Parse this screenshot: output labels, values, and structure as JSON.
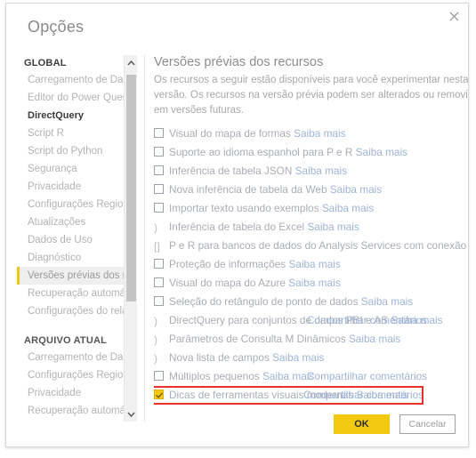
{
  "dialog": {
    "title": "Opções",
    "close_label": "×"
  },
  "sidebar": {
    "groups": [
      {
        "heading": "GLOBAL",
        "items": [
          {
            "label": "Carregamento de Dados",
            "selected": false,
            "bold": false
          },
          {
            "label": "Editor do Power Query",
            "selected": false,
            "bold": false
          },
          {
            "label": "DirectQuery",
            "selected": false,
            "bold": true
          },
          {
            "label": "Script R",
            "selected": false,
            "bold": false
          },
          {
            "label": "Script do Python",
            "selected": false,
            "bold": false
          },
          {
            "label": "Segurança",
            "selected": false,
            "bold": false
          },
          {
            "label": "Privacidade",
            "selected": false,
            "bold": false
          },
          {
            "label": "Configurações Regionais",
            "selected": false,
            "bold": false
          },
          {
            "label": "Atualizações",
            "selected": false,
            "bold": false
          },
          {
            "label": "Dados de Uso",
            "selected": false,
            "bold": false
          },
          {
            "label": "Diagnóstico",
            "selected": false,
            "bold": false
          },
          {
            "label": "Versões prévias dos recursos",
            "selected": true,
            "bold": false
          },
          {
            "label": "Recuperação automática",
            "selected": false,
            "bold": false
          },
          {
            "label": "Configurações do relatório",
            "selected": false,
            "bold": false
          }
        ]
      },
      {
        "heading": "ARQUIVO ATUAL",
        "items": [
          {
            "label": "Carregamento de Dados",
            "selected": false,
            "bold": false
          },
          {
            "label": "Configurações Regionais",
            "selected": false,
            "bold": false
          },
          {
            "label": "Privacidade",
            "selected": false,
            "bold": false
          },
          {
            "label": "Recuperação automática",
            "selected": false,
            "bold": false
          }
        ]
      }
    ],
    "scrollbar": {
      "up_arrow": "scroll-up",
      "down_arrow": "scroll-down"
    }
  },
  "main": {
    "title": "Versões prévias dos recursos",
    "description": "Os recursos a seguir estão disponíveis para você experimentar nesta versão. Os recursos na versão prévia podem ser alterados ou removidos em versões futuras.",
    "options": [
      {
        "box": "unchecked",
        "label": "Visual do mapa de formas",
        "link": "Saiba mais",
        "overlay": ""
      },
      {
        "box": "unchecked",
        "label": "Suporte ao idioma espanhol para P e R",
        "link": "Saiba mais",
        "overlay": ""
      },
      {
        "box": "unchecked",
        "label": "Inferência de tabela JSON",
        "link": "Saiba mais",
        "overlay": ""
      },
      {
        "box": "unchecked",
        "label": "Nova inferência de tabela da Web",
        "link": "Saiba mais",
        "overlay": ""
      },
      {
        "box": "unchecked",
        "label": "Importar texto usando exemplos",
        "link": "Saiba mais",
        "overlay": ""
      },
      {
        "box": "glyph-paren",
        "label": "Inferência de tabela do Excel",
        "link": "Saiba mais",
        "overlay": ""
      },
      {
        "box": "glyph-bracket",
        "label": "P e R para bancos de dados do Analysis Services com conexão dinâmica",
        "link": "Saiba mais",
        "overlay": ""
      },
      {
        "box": "unchecked",
        "label": "Proteção de informações",
        "link": "Saiba mais",
        "overlay": ""
      },
      {
        "box": "unchecked",
        "label": "Visual do mapa do Azure",
        "link": "Saiba mais",
        "overlay": ""
      },
      {
        "box": "unchecked",
        "label": "Seleção do retângulo de ponto de dados",
        "link": "Saiba mais",
        "overlay": ""
      },
      {
        "box": "glyph-paren",
        "label": "DirectQuery para conjuntos de dados PBI e AS",
        "link": "Saiba mais",
        "overlay": "Compartilhar comentários"
      },
      {
        "box": "glyph-paren",
        "label": "Parâmetros de Consulta M Dinâmicos",
        "link": "Saiba mais",
        "overlay": ""
      },
      {
        "box": "glyph-paren",
        "label": "Nova lista de campos",
        "link": "Saiba mais",
        "overlay": ""
      },
      {
        "box": "unchecked",
        "label": "Múltiplos pequenos",
        "link": "Saiba mais",
        "overlay": "Compartilhar comentários"
      },
      {
        "box": "checked",
        "label": "Dicas de ferramentas visuais modernas",
        "link": "Saiba mais",
        "overlay": "Compartilhar comentários",
        "highlighted": true
      }
    ]
  },
  "footer": {
    "ok_label": "OK",
    "cancel_label": "Cancelar"
  },
  "colors": {
    "accent": "#f2c811",
    "highlight_border": "#e8312f",
    "link": "#9fb4d8",
    "text_muted": "#a9adb5"
  }
}
